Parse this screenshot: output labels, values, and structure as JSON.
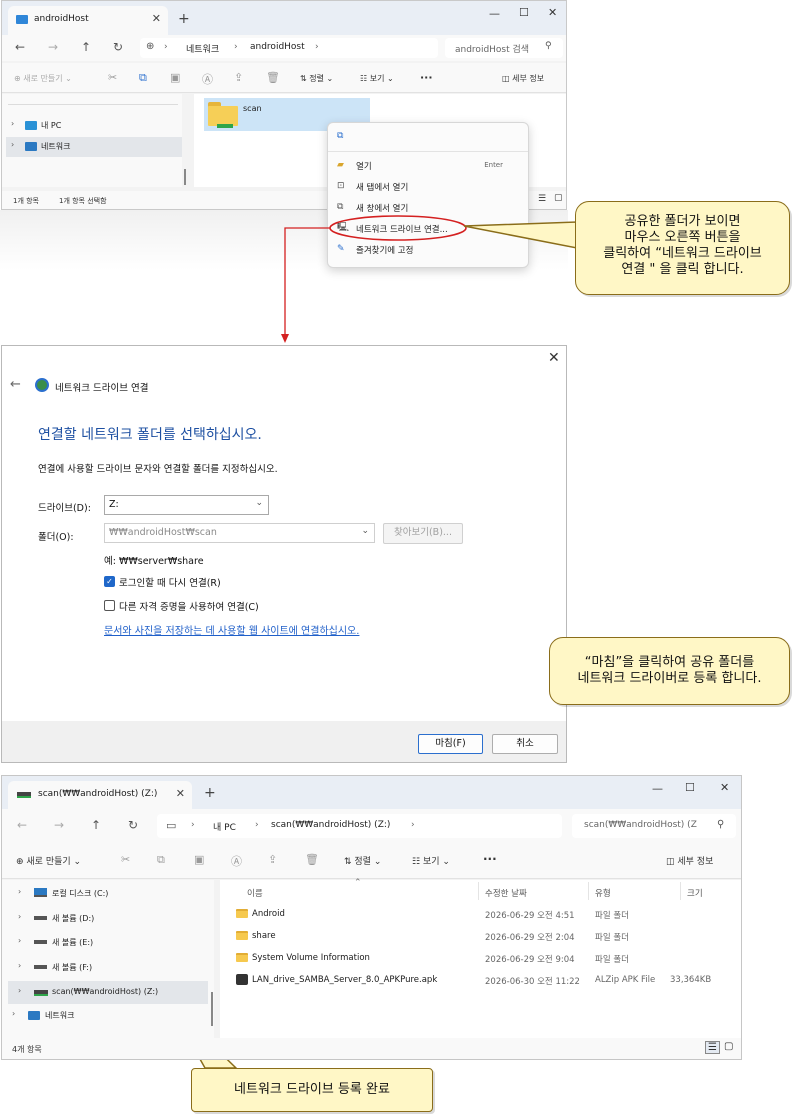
{
  "window1": {
    "tab_title": "androidHost",
    "breadcrumb": [
      "네트워크",
      "androidHost"
    ],
    "search_placeholder": "androidHost 검색",
    "toolbar": {
      "new": "새로 만들기",
      "sort": "정렬",
      "view": "보기",
      "more": "···",
      "details": "세부 정보"
    },
    "nav_items": [
      "내 PC",
      "네트워크"
    ],
    "folder_name": "scan",
    "status_count": "1개 항목",
    "status_selected": "1개 항목 선택함"
  },
  "context_menu": {
    "items": [
      {
        "icon": "copy-icon",
        "label": ""
      },
      {
        "icon": "folder-open-icon",
        "label": "열기",
        "shortcut": "Enter"
      },
      {
        "icon": "new-tab-icon",
        "label": "새 탭에서 열기"
      },
      {
        "icon": "new-window-icon",
        "label": "새 창에서 열기"
      },
      {
        "icon": "network-drive-icon",
        "label": "네트워크 드라이브 연결..."
      },
      {
        "icon": "pin-icon",
        "label": "즐겨찾기에 고정"
      }
    ]
  },
  "callout1": {
    "lines": [
      "공유한 폴더가 보이면",
      "마우스 오른쪽 버튼을",
      "클릭하여 “네트워크 드라이브",
      "연결 \" 을 클릭 합니다."
    ]
  },
  "dialog": {
    "title": "네트워크 드라이브 연결",
    "heading": "연결할 네트워크 폴더를 선택하십시오.",
    "instruction": "연결에 사용할 드라이브 문자와 연결할 폴더를 지정하십시오.",
    "drive_label": "드라이브(D):",
    "drive_value": "Z:",
    "folder_label": "폴더(O):",
    "folder_value": "₩₩androidHost₩scan",
    "browse_button": "찾아보기(B)...",
    "example": "예: ₩₩server₩share",
    "reconnect_label": "로그인할 때 다시 연결(R)",
    "reconnect_checked": true,
    "other_credentials_label": "다른 자격 증명을 사용하여 연결(C)",
    "other_credentials_checked": false,
    "link": "문서와 사진을 저장하는 데 사용할 웹 사이트에 연결하십시오.",
    "finish_button": "마침(F)",
    "cancel_button": "취소"
  },
  "callout2": {
    "lines": [
      "“마침”을 클릭하여 공유 폴더를",
      "네트워크 드라이버로 등록 합니다."
    ]
  },
  "window3": {
    "tab_title": "scan(₩₩androidHost) (Z:)",
    "breadcrumb": [
      "내 PC",
      "scan(₩₩androidHost) (Z:)"
    ],
    "search_placeholder": "scan(₩₩androidHost) (Z",
    "toolbar": {
      "new": "새로 만들기",
      "sort": "정렬",
      "view": "보기",
      "more": "···",
      "details": "세부 정보"
    },
    "nav_items": [
      {
        "label": "로컬 디스크 (C:)",
        "icon": "local-disk-icon"
      },
      {
        "label": "새 볼륨 (D:)",
        "icon": "drive-icon"
      },
      {
        "label": "새 볼륨 (E:)",
        "icon": "drive-icon"
      },
      {
        "label": "새 볼륨 (F:)",
        "icon": "drive-icon"
      },
      {
        "label": "scan(₩₩androidHost) (Z:)",
        "icon": "network-drive-icon"
      },
      {
        "label": "네트워크",
        "icon": "network-icon"
      }
    ],
    "columns": [
      "이름",
      "수정한 날짜",
      "유형",
      "크기"
    ],
    "files": [
      {
        "name": "Android",
        "date": "2026-06-29 오전 4:51",
        "type": "파일 폴더",
        "size": ""
      },
      {
        "name": "share",
        "date": "2026-06-29 오전 2:04",
        "type": "파일 폴더",
        "size": ""
      },
      {
        "name": "System Volume Information",
        "date": "2026-06-29 오전 9:04",
        "type": "파일 폴더",
        "size": ""
      },
      {
        "name": "LAN_drive_SAMBA_Server_8.0_APKPure.apk",
        "date": "2026-06-30 오전 11:22",
        "type": "ALZip APK File",
        "size": "33,364KB"
      }
    ],
    "status_count": "4개 항목"
  },
  "callout3": {
    "text": "네트워크 드라이브 등록 완료"
  },
  "colors": {
    "arrow_red": "#d42020",
    "callout_fill": "#fff7c6",
    "heading_blue": "#1e50a2",
    "link_blue": "#1f5fc9"
  }
}
